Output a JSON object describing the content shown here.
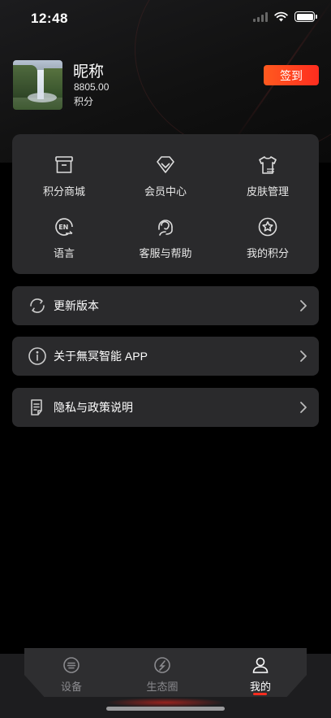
{
  "status_bar": {
    "time": "12:48"
  },
  "profile": {
    "nickname": "昵称",
    "points_value": "8805.00",
    "points_label": "积分",
    "checkin_label": "签到"
  },
  "grid": {
    "items": [
      {
        "label": "积分商城",
        "icon": "store-box-icon"
      },
      {
        "label": "会员中心",
        "icon": "diamond-icon"
      },
      {
        "label": "皮肤管理",
        "icon": "tshirt-icon"
      },
      {
        "label": "语言",
        "icon": "language-icon"
      },
      {
        "label": "客服与帮助",
        "icon": "headset-icon"
      },
      {
        "label": "我的积分",
        "icon": "star-circle-icon"
      }
    ]
  },
  "list": {
    "items": [
      {
        "label": "更新版本",
        "icon": "refresh-icon"
      },
      {
        "label": "关于無冥智能 APP",
        "icon": "info-icon"
      },
      {
        "label": "隐私与政策说明",
        "icon": "document-icon"
      }
    ]
  },
  "tabbar": {
    "tabs": [
      {
        "label": "设备",
        "icon": "device-icon",
        "active": false
      },
      {
        "label": "生态圈",
        "icon": "ecosystem-icon",
        "active": false
      },
      {
        "label": "我的",
        "icon": "user-icon",
        "active": true
      }
    ]
  },
  "colors": {
    "accent": "#ff2d1f",
    "card": "#2a2a2c",
    "background": "#000000"
  }
}
